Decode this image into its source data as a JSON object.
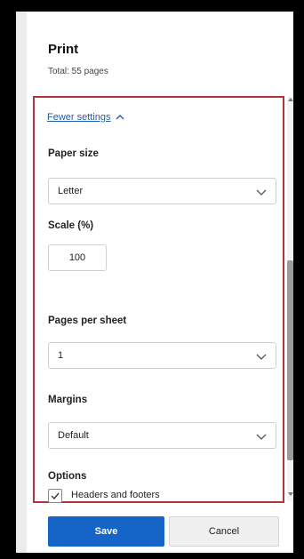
{
  "dialog": {
    "title": "Print",
    "subtitle": "Total: 55 pages",
    "fewer_settings_label": "Fewer settings"
  },
  "settings": {
    "paper_size": {
      "label": "Paper size",
      "value": "Letter"
    },
    "scale": {
      "label": "Scale (%)",
      "value": "100"
    },
    "pages_per_sheet": {
      "label": "Pages per sheet",
      "value": "1"
    },
    "margins": {
      "label": "Margins",
      "value": "Default"
    },
    "options": {
      "label": "Options",
      "headers_footers_label": "Headers and footers",
      "headers_footers_checked": true
    }
  },
  "buttons": {
    "save_label": "Save",
    "cancel_label": "Cancel"
  },
  "colors": {
    "accent": "#1565c8",
    "highlight_border": "#b3343c",
    "link": "#1f5fa8"
  },
  "icons": [
    "chevron-up-icon",
    "chevron-down-icon",
    "checkmark-icon",
    "scroll-up-arrow-icon",
    "scroll-down-arrow-icon"
  ]
}
